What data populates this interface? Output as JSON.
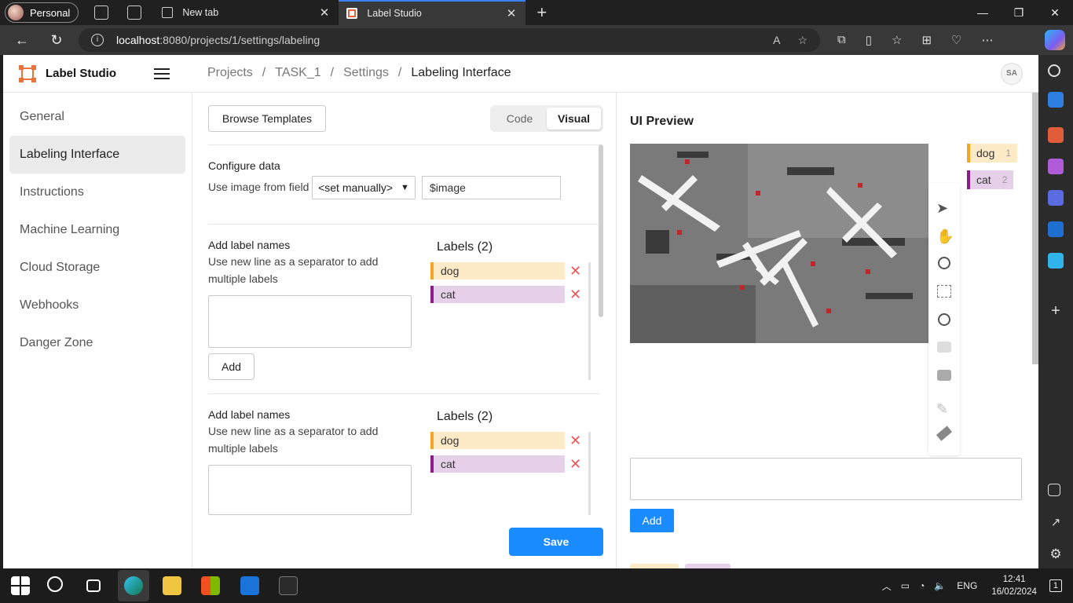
{
  "browser": {
    "profile": "Personal",
    "tabs": [
      {
        "title": "New tab",
        "active": false
      },
      {
        "title": "Label Studio",
        "active": true
      }
    ],
    "url_host": "localhost",
    "url_path": ":8080/projects/1/settings/labeling"
  },
  "app": {
    "name": "Label Studio",
    "avatar": "SA",
    "breadcrumbs": [
      "Projects",
      "TASK_1",
      "Settings",
      "Labeling Interface"
    ],
    "separator": "/"
  },
  "sidebar": {
    "items": [
      {
        "label": "General",
        "active": false
      },
      {
        "label": "Labeling Interface",
        "active": true
      },
      {
        "label": "Instructions",
        "active": false
      },
      {
        "label": "Machine Learning",
        "active": false
      },
      {
        "label": "Cloud Storage",
        "active": false
      },
      {
        "label": "Webhooks",
        "active": false
      },
      {
        "label": "Danger Zone",
        "active": false
      }
    ]
  },
  "config": {
    "browse_label": "Browse Templates",
    "mode_code": "Code",
    "mode_visual": "Visual",
    "configure_title": "Configure data",
    "field_label": "Use image from field",
    "field_select": "<set manually>",
    "field_value": "$image",
    "label_blocks": [
      {
        "title": "Add label names",
        "hint": "Use new line as a separator to add multiple labels",
        "add_label": "Add",
        "labels_heading": "Labels (2)",
        "labels": [
          "dog",
          "cat"
        ]
      },
      {
        "title": "Add label names",
        "hint": "Use new line as a separator to add multiple labels",
        "labels_heading": "Labels (2)",
        "labels": [
          "dog",
          "cat"
        ]
      }
    ],
    "save_label": "Save"
  },
  "preview": {
    "title": "UI Preview",
    "labels": [
      {
        "name": "dog",
        "hotkey": "1"
      },
      {
        "name": "cat",
        "hotkey": "2"
      }
    ],
    "add_label": "Add"
  },
  "taskbar": {
    "lang": "ENG",
    "time": "12:41",
    "date": "16/02/2024",
    "notifications": "1"
  },
  "colors": {
    "accent": "#1a8cff",
    "dog": "#f5a623",
    "cat": "#8b1a8b",
    "logo": "#e8743b"
  }
}
